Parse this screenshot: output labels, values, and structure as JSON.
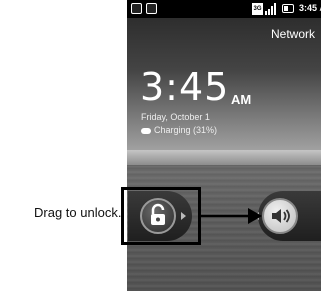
{
  "caption": "Drag to unlock.",
  "status_bar": {
    "network_type": "3G",
    "time": "3:45",
    "time_suffix": "AM"
  },
  "lock_screen": {
    "carrier": "Network",
    "time": "3:45",
    "ampm": "AM",
    "date": "Friday, October 1",
    "charging": "Charging (31%)",
    "battery_level": 0.31
  },
  "controls": {
    "unlock_icon": "lock-icon",
    "sound_icon": "speaker-icon"
  },
  "colors": {
    "callout": "#000000",
    "status_bar_bg": "#000000",
    "text": "#ffffff"
  }
}
